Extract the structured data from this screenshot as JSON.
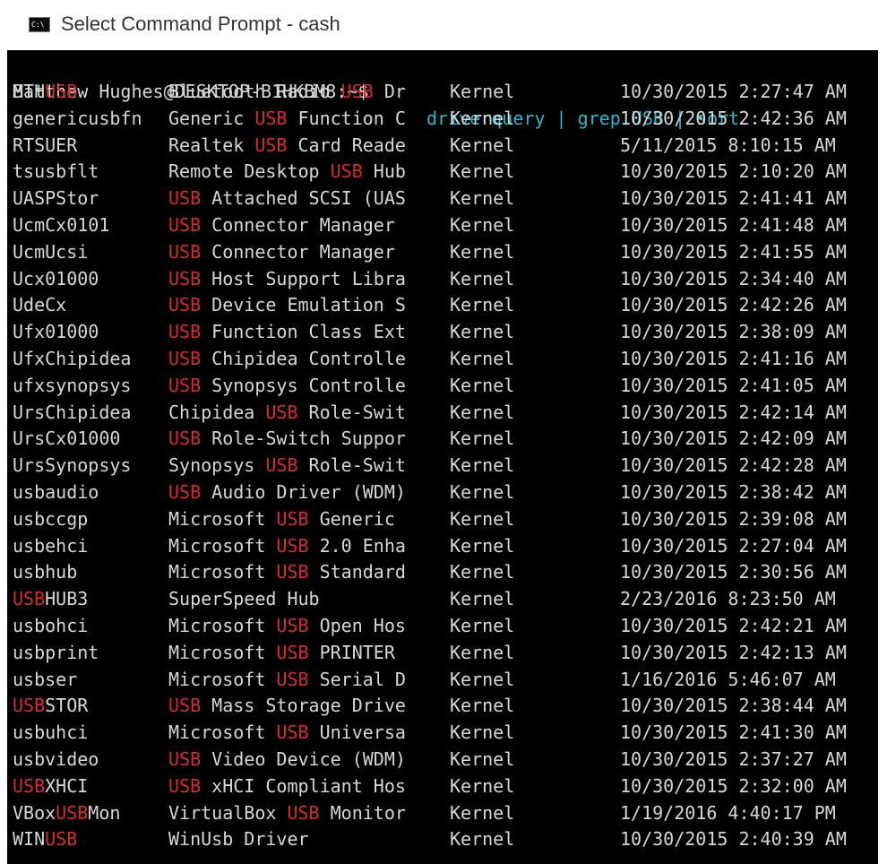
{
  "window": {
    "title": "Select Command Prompt - cash",
    "icon": "cmd-icon",
    "icon_text": "C:\\"
  },
  "console": {
    "colors": {
      "background": "#000000",
      "text": "#d7d7d7",
      "command": "#2bb7c7",
      "highlight": "#d92929"
    },
    "prompt": "Matthew Hughes@DESKTOP-B1HKBM8:~$ ",
    "command": "driverquery | grep USB | sort",
    "highlight_term": "USB",
    "rows": [
      {
        "module": "BTHUSB",
        "name": "Bluetooth Radio USB Dr",
        "type": "Kernel",
        "date": "10/30/2015 2:27:47 AM"
      },
      {
        "module": "genericusbfn",
        "name": "Generic USB Function C",
        "type": "Kernel",
        "date": "10/30/2015 2:42:36 AM"
      },
      {
        "module": "RTSUER",
        "name": "Realtek USB Card Reade",
        "type": "Kernel",
        "date": "5/11/2015 8:10:15 AM"
      },
      {
        "module": "tsusbflt",
        "name": "Remote Desktop USB Hub",
        "type": "Kernel",
        "date": "10/30/2015 2:10:20 AM"
      },
      {
        "module": "UASPStor",
        "name": "USB Attached SCSI (UAS",
        "type": "Kernel",
        "date": "10/30/2015 2:41:41 AM"
      },
      {
        "module": "UcmCx0101",
        "name": "USB Connector Manager",
        "type": "Kernel",
        "date": "10/30/2015 2:41:48 AM"
      },
      {
        "module": "UcmUcsi",
        "name": "USB Connector Manager",
        "type": "Kernel",
        "date": "10/30/2015 2:41:55 AM"
      },
      {
        "module": "Ucx01000",
        "name": "USB Host Support Libra",
        "type": "Kernel",
        "date": "10/30/2015 2:34:40 AM"
      },
      {
        "module": "UdeCx",
        "name": "USB Device Emulation S",
        "type": "Kernel",
        "date": "10/30/2015 2:42:26 AM"
      },
      {
        "module": "Ufx01000",
        "name": "USB Function Class Ext",
        "type": "Kernel",
        "date": "10/30/2015 2:38:09 AM"
      },
      {
        "module": "UfxChipidea",
        "name": "USB Chipidea Controlle",
        "type": "Kernel",
        "date": "10/30/2015 2:41:16 AM"
      },
      {
        "module": "ufxsynopsys",
        "name": "USB Synopsys Controlle",
        "type": "Kernel",
        "date": "10/30/2015 2:41:05 AM"
      },
      {
        "module": "UrsChipidea",
        "name": "Chipidea USB Role-Swit",
        "type": "Kernel",
        "date": "10/30/2015 2:42:14 AM"
      },
      {
        "module": "UrsCx01000",
        "name": "USB Role-Switch Suppor",
        "type": "Kernel",
        "date": "10/30/2015 2:42:09 AM"
      },
      {
        "module": "UrsSynopsys",
        "name": "Synopsys USB Role-Swit",
        "type": "Kernel",
        "date": "10/30/2015 2:42:28 AM"
      },
      {
        "module": "usbaudio",
        "name": "USB Audio Driver (WDM)",
        "type": "Kernel",
        "date": "10/30/2015 2:38:42 AM"
      },
      {
        "module": "usbccgp",
        "name": "Microsoft USB Generic",
        "type": "Kernel",
        "date": "10/30/2015 2:39:08 AM"
      },
      {
        "module": "usbehci",
        "name": "Microsoft USB 2.0 Enha",
        "type": "Kernel",
        "date": "10/30/2015 2:27:04 AM"
      },
      {
        "module": "usbhub",
        "name": "Microsoft USB Standard",
        "type": "Kernel",
        "date": "10/30/2015 2:30:56 AM"
      },
      {
        "module": "USBHUB3",
        "name": "SuperSpeed Hub",
        "type": "Kernel",
        "date": "2/23/2016 8:23:50 AM"
      },
      {
        "module": "usbohci",
        "name": "Microsoft USB Open Hos",
        "type": "Kernel",
        "date": "10/30/2015 2:42:21 AM"
      },
      {
        "module": "usbprint",
        "name": "Microsoft USB PRINTER",
        "type": "Kernel",
        "date": "10/30/2015 2:42:13 AM"
      },
      {
        "module": "usbser",
        "name": "Microsoft USB Serial D",
        "type": "Kernel",
        "date": "1/16/2016 5:46:07 AM"
      },
      {
        "module": "USBSTOR",
        "name": "USB Mass Storage Drive",
        "type": "Kernel",
        "date": "10/30/2015 2:38:44 AM"
      },
      {
        "module": "usbuhci",
        "name": "Microsoft USB Universa",
        "type": "Kernel",
        "date": "10/30/2015 2:41:30 AM"
      },
      {
        "module": "usbvideo",
        "name": "USB Video Device (WDM)",
        "type": "Kernel",
        "date": "10/30/2015 2:37:27 AM"
      },
      {
        "module": "USBXHCI",
        "name": "USB xHCI Compliant Hos",
        "type": "Kernel",
        "date": "10/30/2015 2:32:00 AM"
      },
      {
        "module": "VBoxUSBMon",
        "name": "VirtualBox USB Monitor",
        "type": "Kernel",
        "date": "1/19/2016 4:40:17 PM"
      },
      {
        "module": "WINUSB",
        "name": "WinUsb Driver",
        "type": "Kernel",
        "date": "10/30/2015 2:40:39 AM"
      }
    ]
  }
}
